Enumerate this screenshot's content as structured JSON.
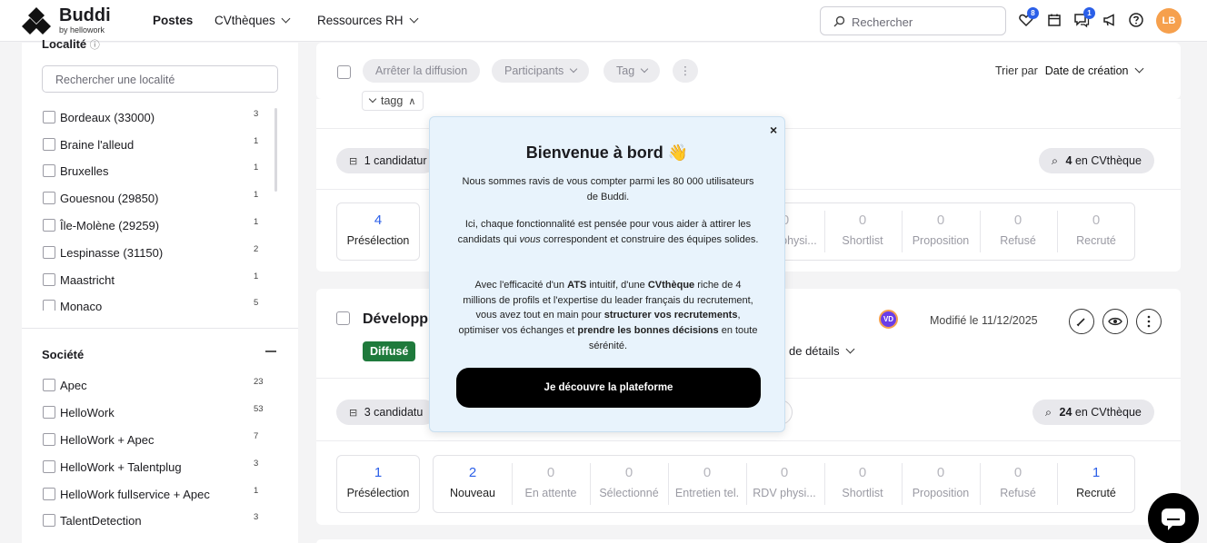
{
  "header": {
    "brand": "Buddi",
    "brand_sub": "by hellowork",
    "nav": [
      {
        "label": "Postes",
        "active": true
      },
      {
        "label": "CVthèques",
        "active": false
      },
      {
        "label": "Ressources RH",
        "active": false
      }
    ],
    "search_placeholder": "Rechercher",
    "badges": {
      "favorites": "8",
      "messages": "1"
    },
    "avatar": "LB",
    "icons": [
      "heart-icon",
      "calendar-icon",
      "chat-icon",
      "megaphone-icon",
      "help-icon"
    ]
  },
  "sidebar": {
    "locality_title": "Localité",
    "locality_search_placeholder": "Rechercher une localité",
    "localities": [
      {
        "label": "Bordeaux (33000)",
        "count": "3"
      },
      {
        "label": "Braine l'alleud",
        "count": "1"
      },
      {
        "label": "Bruxelles",
        "count": "1"
      },
      {
        "label": "Gouesnou (29850)",
        "count": "1"
      },
      {
        "label": "Île-Molène (29259)",
        "count": "1"
      },
      {
        "label": "Lespinasse (31150)",
        "count": "2"
      },
      {
        "label": "Maastricht",
        "count": "1"
      },
      {
        "label": "Monaco",
        "count": "5"
      }
    ],
    "company_title": "Société",
    "companies": [
      {
        "label": "Apec",
        "count": "23"
      },
      {
        "label": "HelloWork",
        "count": "53"
      },
      {
        "label": "HelloWork + Apec",
        "count": "7"
      },
      {
        "label": "HelloWork + Talentplug",
        "count": "3"
      },
      {
        "label": "HelloWork fullservice + Apec",
        "count": "1"
      },
      {
        "label": "TalentDetection",
        "count": "3"
      }
    ]
  },
  "toolbar": {
    "stop_label": "Arrêter la diffusion",
    "participants_label": "Participants",
    "tag_label": "Tag",
    "more_label": "⋮",
    "sort_prefix": "Trier par",
    "sort_value": "Date de création"
  },
  "job1": {
    "tag_label": "tagg",
    "applications": "1 candidatur",
    "cvtheque_count": "4",
    "cvtheque_label": "en CVthèque",
    "stages": [
      {
        "n": "4",
        "t": "Présélection"
      },
      {
        "n": "0",
        "t": "RDV physi..."
      },
      {
        "n": "0",
        "t": "Shortlist"
      },
      {
        "n": "0",
        "t": "Proposition"
      },
      {
        "n": "0",
        "t": "Refusé"
      },
      {
        "n": "0",
        "t": "Recruté"
      }
    ]
  },
  "job2": {
    "title": "Développ",
    "status": "Diffusé",
    "avatar": "VD",
    "modified": "Modifié le 11/12/2025",
    "details_label": "de détails",
    "applications": "3 candidatu",
    "cvtheque_count": "24",
    "cvtheque_label": "en CVthèque",
    "preselection": {
      "n": "1",
      "t": "Présélection"
    },
    "stages": [
      {
        "n": "2",
        "t": "Nouveau"
      },
      {
        "n": "0",
        "t": "En attente"
      },
      {
        "n": "0",
        "t": "Sélectionné"
      },
      {
        "n": "0",
        "t": "Entretien tel."
      },
      {
        "n": "0",
        "t": "RDV physi..."
      },
      {
        "n": "0",
        "t": "Shortlist"
      },
      {
        "n": "0",
        "t": "Proposition"
      },
      {
        "n": "0",
        "t": "Refusé"
      },
      {
        "n": "1",
        "t": "Recruté"
      }
    ]
  },
  "modal": {
    "title": "Bienvenue à bord",
    "emoji": "👋",
    "p1": "Nous sommes ravis de vous compter parmi les 80 000 utilisateurs de Buddi.",
    "p2": "Ici, chaque fonctionnalité est pensée pour vous aider à attirer les candidats qui vous correspondent et construire des équipes solides.",
    "p3": "Avec l'efficacité d'un ATS intuitif, d'une CVthèque riche de 4 millions de profils et l'expertise du leader français du recrutement, vous avez tout en main pour structurer vos recrutements, optimiser vos échanges et prendre les bonnes décisions en toute sérénité.",
    "cta": "Je découvre la plateforme",
    "close": "×"
  },
  "colors": {
    "accent": "#2b5fe8",
    "success": "#1f7a3c",
    "modal_bg": "#e8f3fc",
    "avatar_bg": "#f6a04d"
  }
}
